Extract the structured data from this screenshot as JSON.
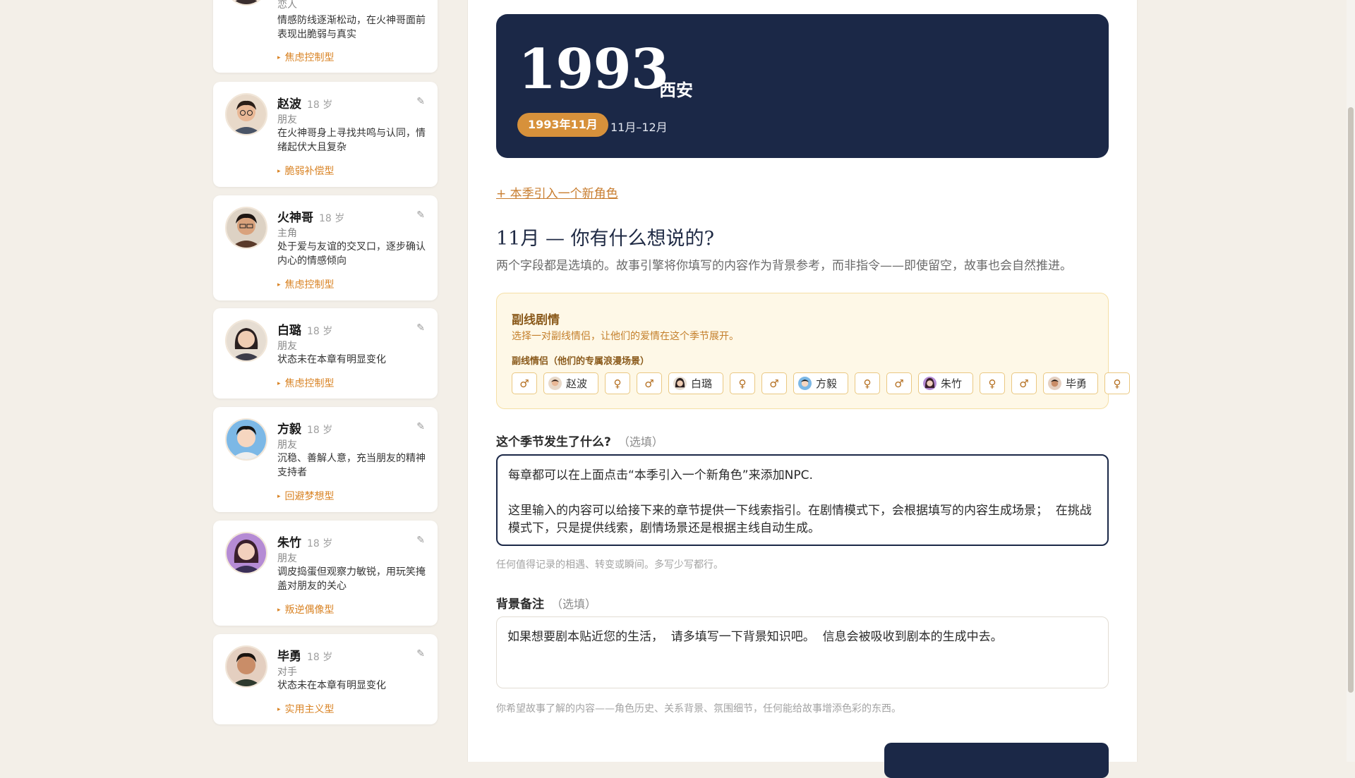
{
  "characters": [
    {
      "name": "",
      "age": "",
      "role": "恋人",
      "desc": "情感防线逐渐松动，在火神哥面前表现出脆弱与真实",
      "tag": "焦虑控制型"
    },
    {
      "name": "赵波",
      "age": "18 岁",
      "role": "朋友",
      "desc": "在火神哥身上寻找共鸣与认同，情绪起伏大且复杂",
      "tag": "脆弱补偿型"
    },
    {
      "name": "火神哥",
      "age": "18 岁",
      "role": "主角",
      "desc": "处于爱与友谊的交叉口，逐步确认内心的情感倾向",
      "tag": "焦虑控制型"
    },
    {
      "name": "白璐",
      "age": "18 岁",
      "role": "朋友",
      "desc": "状态未在本章有明显变化",
      "tag": "焦虑控制型"
    },
    {
      "name": "方毅",
      "age": "18 岁",
      "role": "朋友",
      "desc": "沉稳、善解人意，充当朋友的精神支持者",
      "tag": "回避梦想型"
    },
    {
      "name": "朱竹",
      "age": "18 岁",
      "role": "朋友",
      "desc": "调皮捣蛋但观察力敏锐，用玩笑掩盖对朋友的关心",
      "tag": "叛逆偶像型"
    },
    {
      "name": "毕勇",
      "age": "18 岁",
      "role": "对手",
      "desc": "状态未在本章有明显变化",
      "tag": "实用主义型"
    }
  ],
  "edit_glyph": "✎",
  "tag_glyph": "▸",
  "hero": {
    "year": "1993",
    "city": "西安",
    "month_pill": "1993年11月",
    "range": "11月–12月"
  },
  "add_character_link": "+ 本季引入一个新角色",
  "question": {
    "title": "11月 — 你有什么想说的?",
    "subtitle": "两个字段都是选填的。故事引擎将你填写的内容作为背景参考，而非指令——即使留空，故事也会自然推进。"
  },
  "subplot": {
    "title": "副线剧情",
    "desc": "选择一对副线情侣，让他们的爱情在这个季节展开。",
    "pairs_label": "副线情侣（他们的专属浪漫场景）",
    "male_glyph": "♂",
    "female_glyph": "♀",
    "pairs": [
      "赵波",
      "白璐",
      "方毅",
      "朱竹",
      "毕勇"
    ]
  },
  "field1": {
    "label": "这个季节发生了什么?",
    "optional": "（选填）",
    "value": "每章都可以在上面点击“本季引入一个新角色”来添加NPC.\n\n这里输入的内容可以给接下来的章节提供一下线索指引。在剧情模式下，会根据填写的内容生成场景；  在挑战模式下，只是提供线索，剧情场景还是根据主线自动生成。",
    "hint": "任何值得记录的相遇、转变或瞬间。多写少写都行。"
  },
  "field2": {
    "label": "背景备注",
    "optional": "（选填）",
    "value": "如果想要剧本贴近您的生活，  请多填写一下背景知识吧。  信息会被吸收到剧本的生成中去。",
    "hint": "你希望故事了解的内容——角色历史、关系背景、氛围细节，任何能给故事增添色彩的东西。"
  }
}
